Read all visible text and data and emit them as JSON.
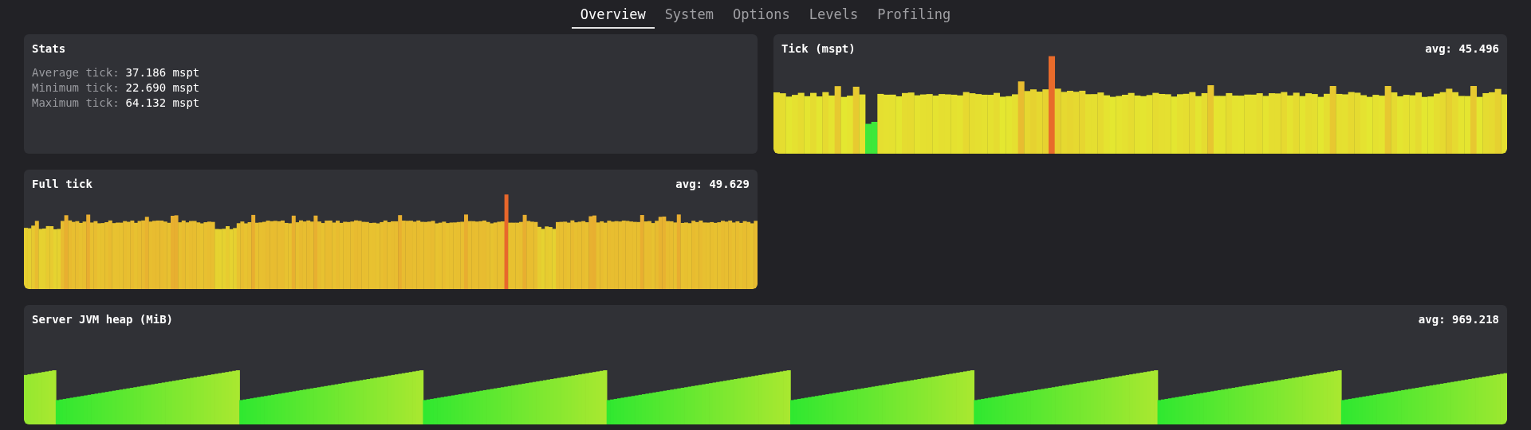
{
  "tabs": [
    {
      "label": "Overview",
      "selected": true
    },
    {
      "label": "System",
      "selected": false
    },
    {
      "label": "Options",
      "selected": false
    },
    {
      "label": "Levels",
      "selected": false
    },
    {
      "label": "Profiling",
      "selected": false
    }
  ],
  "stats": {
    "title": "Stats",
    "lines": [
      {
        "label": "Average tick:",
        "value": "37.186 mspt"
      },
      {
        "label": "Minimum tick:",
        "value": "22.690 mspt"
      },
      {
        "label": "Maximum tick:",
        "value": "64.132 mspt"
      }
    ]
  },
  "charts": [
    {
      "kind": "tick",
      "title": "Tick (mspt)",
      "average": "avg: 45.496"
    },
    {
      "kind": "fulltick",
      "title": "Full tick",
      "average": "avg: 49.629"
    },
    {
      "kind": "heap",
      "title": "Server JVM heap (MiB)",
      "average": "avg: 969.218"
    }
  ]
}
